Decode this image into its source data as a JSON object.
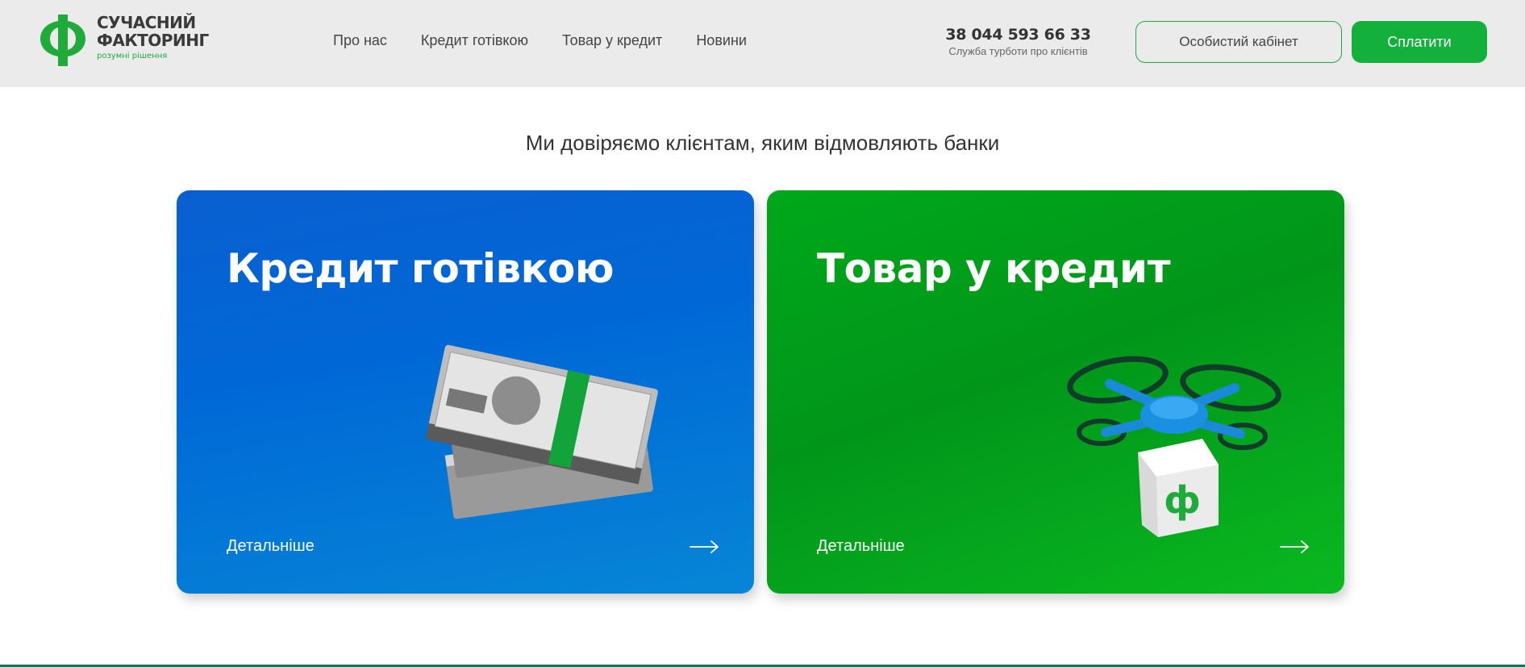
{
  "brand": {
    "name_line1": "СУЧАСНИЙ",
    "name_line2": "ФАКТОРИНГ",
    "tagline": "розумні рішення",
    "color": "#1faa3a"
  },
  "nav": {
    "items": [
      {
        "label": "Про нас"
      },
      {
        "label": "Кредит готівкою"
      },
      {
        "label": "Товар у кредит"
      },
      {
        "label": "Новини"
      }
    ]
  },
  "contact": {
    "phone": "38 044 593 66 33",
    "phone_caption": "Служба турботи про клієнтів"
  },
  "header_buttons": {
    "cabinet_label": "Особистий кабінет",
    "pay_label": "Сплатити"
  },
  "main": {
    "tagline": "Ми довіряємо клієнтам, яким відмовляють банки",
    "cards": [
      {
        "title": "Кредит готівкою",
        "link_label": "Детальніше",
        "illustration": "banknote-stack",
        "color": "#0068d6"
      },
      {
        "title": "Товар у кредит",
        "link_label": "Детальніше",
        "illustration": "drone-with-box",
        "color": "#01961a"
      }
    ]
  },
  "icons": {
    "logo": "logo-mark-icon",
    "arrow": "arrow-right-icon"
  }
}
